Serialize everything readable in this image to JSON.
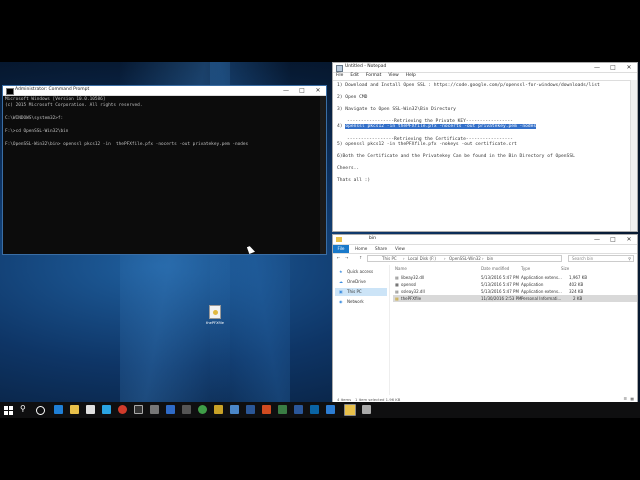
{
  "cmd": {
    "title": "Administrator: Command Prompt",
    "lines": [
      "Microsoft Windows [Version 10.0.10586]",
      "(c) 2015 Microsoft Corporation. All rights reserved.",
      "",
      "C:\\WINDOWS\\system32>f:",
      "",
      "F:\\>cd OpenSSL-Win32\\bin",
      "",
      "F:\\OpenSSL-Win32\\bin> openssl pkcs12 -in  thePFXfile.pfx -nocerts -out privatekey.pem -nodes"
    ]
  },
  "notepad": {
    "title": "Untitled - Notepad",
    "menu": [
      "File",
      "Edit",
      "Format",
      "View",
      "Help"
    ],
    "line1": "1) Download and Install Open SSL : https://code.google.com/p/openssl-for-windows/downloads/list",
    "line2": "2) Open CMD",
    "line3": "3) Navigate to Open SSL-Win32\\Bin Directory",
    "line4": "-----------------Retrieving the Private KEY-----------------",
    "line5_prefix": "4) ",
    "line5_sel": "openssl pkcs12 -in  thePFXfile.pfx -nocerts -out privatekey.pem -nodes",
    "line6": "-----------------Retrieving the Certificate-----------------",
    "line7": "5) openssl pkcs12 -in  thePFXfile.pfx -nokeys -out certificate.crt",
    "line8": "6)Both the Certificate and the Privatekey Can be found in the Bin Directory of OpenSSL",
    "line9": "Cheers..",
    "line10": "Thats all :)"
  },
  "explorer": {
    "title": "bin",
    "ribbon_tabs": [
      "File",
      "Home",
      "Share",
      "View"
    ],
    "path": [
      "This PC",
      "Local Disk (F:)",
      "OpenSSL-Win32",
      "bin"
    ],
    "search_placeholder": "Search bin",
    "nav": [
      "Quick access",
      "OneDrive",
      "This PC",
      "Network"
    ],
    "columns": [
      "Name",
      "Date modified",
      "Type",
      "Size"
    ],
    "rows": [
      {
        "name": "libeay32.dll",
        "date": "5/13/2016 5:47 PM",
        "type": "Application extens...",
        "size": "1,967 KB"
      },
      {
        "name": "openssl",
        "date": "5/13/2016 5:47 PM",
        "type": "Application",
        "size": "402 KB"
      },
      {
        "name": "ssleay32.dll",
        "date": "5/13/2016 5:47 PM",
        "type": "Application extens...",
        "size": "324 KB"
      },
      {
        "name": "thePFXfile",
        "date": "11/30/2016 2:53 PM",
        "type": "Personal Informati...",
        "size": "2 KB"
      }
    ],
    "status_items": "4 items",
    "status_selected": "1 item selected  1.96 KB"
  },
  "desktop_icon": {
    "label": "thePFXfile"
  },
  "colors": {
    "selection": "#3470c9",
    "cmd_bg": "#0c0c0c",
    "cmd_text": "#c0c0c0",
    "taskbar": "#0f0f10",
    "accent": "#0078d7"
  }
}
